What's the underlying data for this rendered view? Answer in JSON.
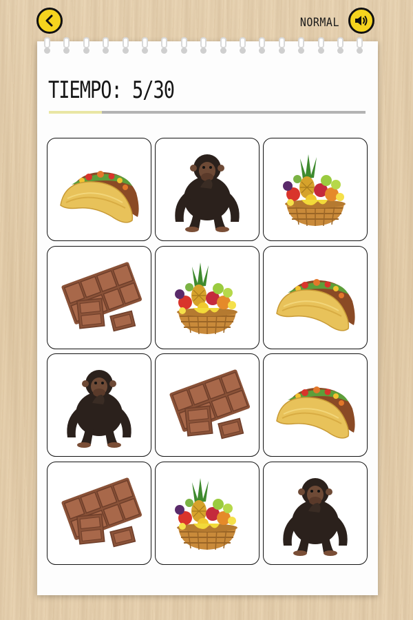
{
  "header": {
    "back_icon": "back-chevron-icon",
    "difficulty": "NORMAL",
    "sound_icon": "speaker-icon",
    "accent_color": "#f5d41e"
  },
  "game": {
    "timer_label": "TIEMPO: 5/30",
    "time_elapsed": 5,
    "time_total": 30,
    "progress_fraction": 0.1667,
    "progress_fill_color": "#e9e6a4",
    "progress_track_color": "#b3b3b3"
  },
  "cards": [
    {
      "row": 1,
      "col": 1,
      "item": "taco"
    },
    {
      "row": 1,
      "col": 2,
      "item": "chimpanzee"
    },
    {
      "row": 1,
      "col": 3,
      "item": "fruit-basket"
    },
    {
      "row": 2,
      "col": 1,
      "item": "chocolate"
    },
    {
      "row": 2,
      "col": 2,
      "item": "fruit-basket"
    },
    {
      "row": 2,
      "col": 3,
      "item": "taco"
    },
    {
      "row": 3,
      "col": 1,
      "item": "chimpanzee"
    },
    {
      "row": 3,
      "col": 2,
      "item": "chocolate"
    },
    {
      "row": 3,
      "col": 3,
      "item": "taco"
    },
    {
      "row": 4,
      "col": 1,
      "item": "chocolate"
    },
    {
      "row": 4,
      "col": 2,
      "item": "fruit-basket"
    },
    {
      "row": 4,
      "col": 3,
      "item": "chimpanzee"
    }
  ]
}
